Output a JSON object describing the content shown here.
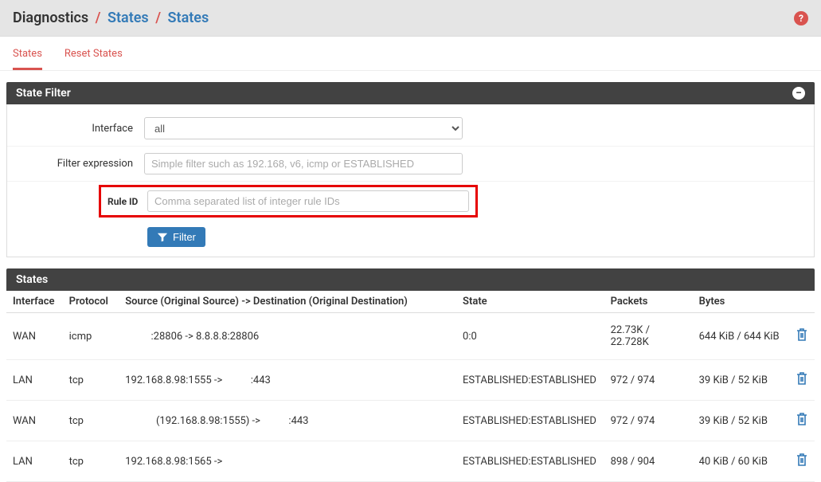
{
  "breadcrumb": {
    "root": "Diagnostics",
    "mid": "States",
    "leaf": "States"
  },
  "tabs": {
    "states": "States",
    "reset": "Reset States"
  },
  "filter_panel": {
    "title": "State Filter",
    "interface_label": "Interface",
    "interface_value": "all",
    "expr_label": "Filter expression",
    "expr_placeholder": "Simple filter such as 192.168, v6, icmp or ESTABLISHED",
    "ruleid_label": "Rule ID",
    "ruleid_placeholder": "Comma separated list of integer rule IDs",
    "filter_btn": "Filter"
  },
  "states_panel": {
    "title": "States",
    "cols": {
      "iface": "Interface",
      "proto": "Protocol",
      "route": "Source (Original Source) -> Destination (Original Destination)",
      "state": "State",
      "packets": "Packets",
      "bytes": "Bytes"
    },
    "rows": [
      {
        "iface": "WAN",
        "proto": "icmp",
        "route": "          :28806 -> 8.8.8.8:28806",
        "state": "0:0",
        "packets": "22.73K / 22.728K",
        "bytes": "644 KiB / 644 KiB"
      },
      {
        "iface": "LAN",
        "proto": "tcp",
        "route": "192.168.8.98:1555 ->           :443",
        "state": "ESTABLISHED:ESTABLISHED",
        "packets": "972 / 974",
        "bytes": "39 KiB / 52 KiB"
      },
      {
        "iface": "WAN",
        "proto": "tcp",
        "route": "            (192.168.8.98:1555) ->           :443",
        "state": "ESTABLISHED:ESTABLISHED",
        "packets": "972 / 974",
        "bytes": "39 KiB / 52 KiB"
      },
      {
        "iface": "LAN",
        "proto": "tcp",
        "route": "192.168.8.98:1565 ->            ",
        "state": "ESTABLISHED:ESTABLISHED",
        "packets": "898 / 904",
        "bytes": "40 KiB / 60 KiB"
      }
    ]
  }
}
